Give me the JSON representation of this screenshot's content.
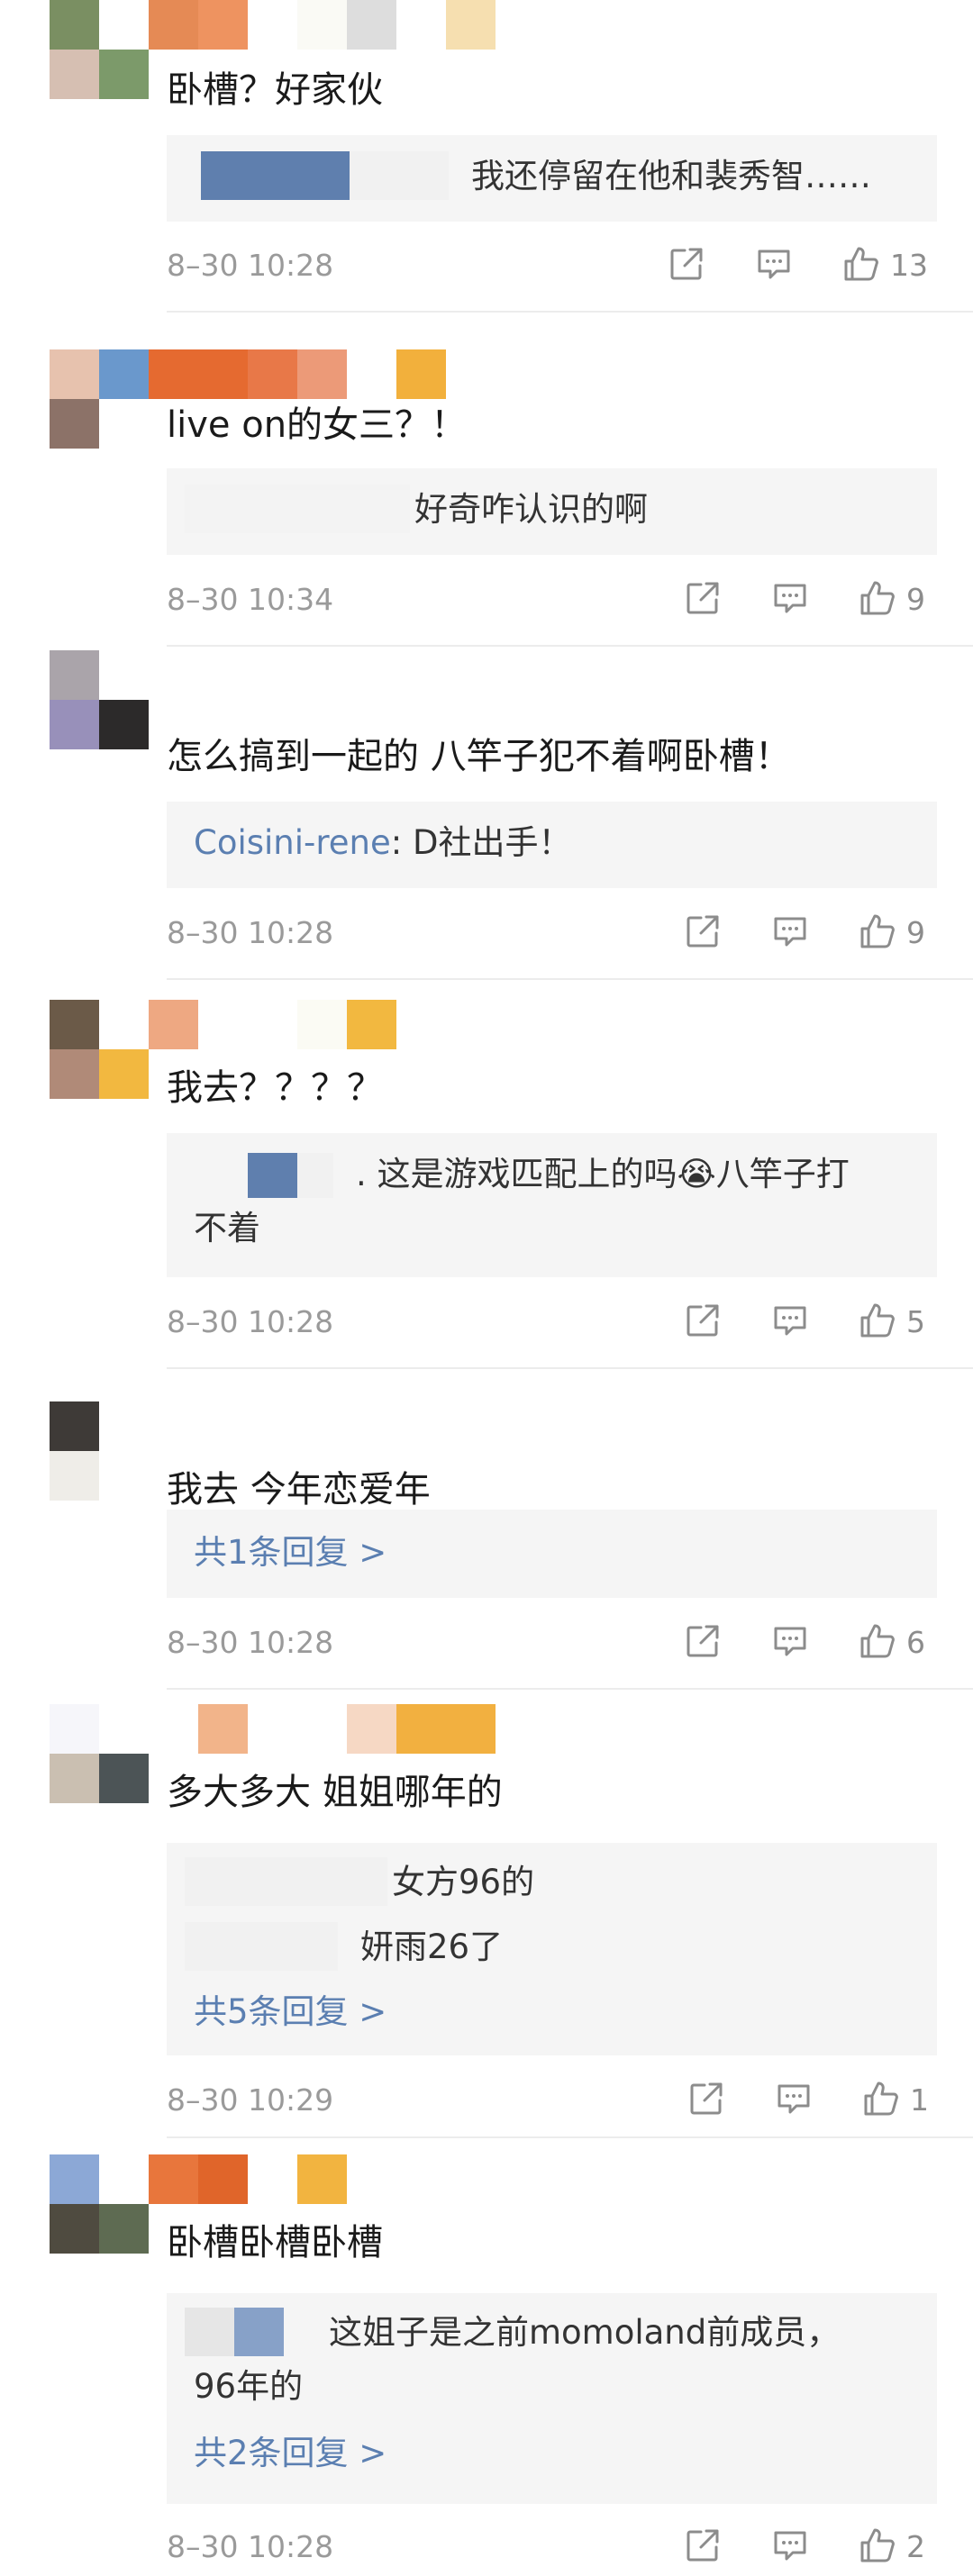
{
  "comments": [
    {
      "text": "卧槽？好家伙",
      "reply": {
        "lines": [
          "我还停留在他和裴秀智……"
        ]
      },
      "time": "8–30 10:28",
      "likes": "13"
    },
    {
      "text": "live on的女三？！",
      "reply": {
        "lines": [
          "好奇咋认识的啊"
        ]
      },
      "time": "8–30 10:34",
      "likes": "9"
    },
    {
      "text": "怎么搞到一起的 八竿子犯不着啊卧槽！",
      "reply": {
        "name": "Coisini-rene",
        "body": ": D社出手！"
      },
      "time": "8–30 10:28",
      "likes": "9"
    },
    {
      "text": "我去？？？？",
      "reply": {
        "lines": [
          ". 这是游戏匹配上的吗😭八竿子打",
          "不着"
        ]
      },
      "time": "8–30 10:28",
      "likes": "5"
    },
    {
      "text": "我去 今年恋爱年",
      "reply": {
        "more": "共1条回复 >"
      },
      "time": "8–30 10:28",
      "likes": "6"
    },
    {
      "text": "多大多大 姐姐哪年的",
      "reply": {
        "lines": [
          "女方96的",
          "妍雨26了"
        ],
        "more": "共5条回复 >"
      },
      "time": "8–30 10:29",
      "likes": "1"
    },
    {
      "text": "卧槽卧槽卧槽",
      "reply": {
        "lines": [
          "这姐子是之前momoland前成员，",
          "96年的"
        ],
        "more": "共2条回复 >"
      },
      "time": "8–30 10:28",
      "likes": "2"
    }
  ],
  "colors": {
    "link": "#5b7fb1",
    "meta": "#9a9a9a",
    "reply_bg": "#f5f5f5"
  },
  "icons": {
    "share": "share-icon",
    "comment": "comment-icon",
    "like": "like-icon"
  }
}
